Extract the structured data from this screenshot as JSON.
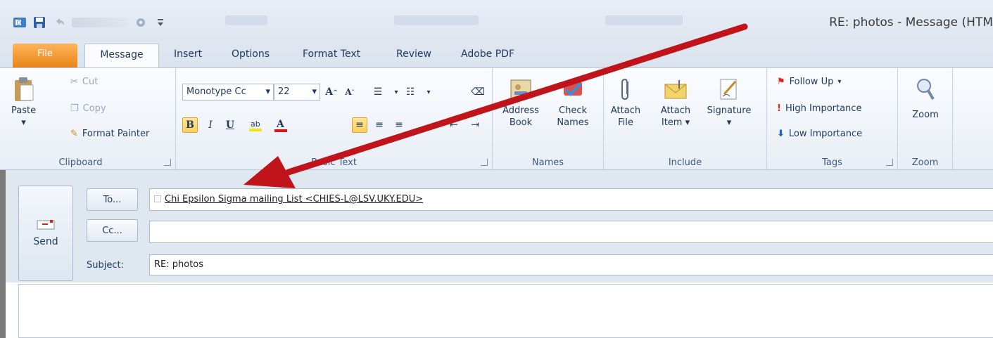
{
  "window": {
    "title": "RE: photos - Message (HTM"
  },
  "tabs": {
    "file": "File",
    "message": "Message",
    "insert": "Insert",
    "options": "Options",
    "format_text": "Format Text",
    "review": "Review",
    "adobe_pdf": "Adobe PDF"
  },
  "clipboard": {
    "paste": "Paste",
    "cut": "Cut",
    "copy": "Copy",
    "format_painter": "Format Painter",
    "label": "Clipboard"
  },
  "basic_text": {
    "font_name": "Monotype Cc",
    "font_size": "22",
    "label": "Basic Text"
  },
  "names": {
    "address_book_line1": "Address",
    "address_book_line2": "Book",
    "check_names_line1": "Check",
    "check_names_line2": "Names",
    "label": "Names"
  },
  "include": {
    "attach_file_line1": "Attach",
    "attach_file_line2": "File",
    "attach_item_line1": "Attach",
    "attach_item_line2": "Item",
    "signature": "Signature",
    "label": "Include"
  },
  "tags": {
    "follow_up": "Follow Up",
    "high_importance": "High Importance",
    "low_importance": "Low Importance",
    "label": "Tags"
  },
  "zoom": {
    "zoom_button": "Zoom",
    "label": "Zoom"
  },
  "form": {
    "send": "Send",
    "to_button": "To...",
    "cc_button": "Cc...",
    "subject_label": "Subject:",
    "to_value": "Chi Epsilon Sigma mailing List <CHIES-L@LSV.UKY.EDU>",
    "cc_value": "",
    "subject_value": "RE: photos"
  },
  "colors": {
    "file_tab": "#e8851a",
    "arrow": "#c0141a",
    "ribbon_bg": "#fbfcfe",
    "form_bg": "#dfe7f1"
  }
}
